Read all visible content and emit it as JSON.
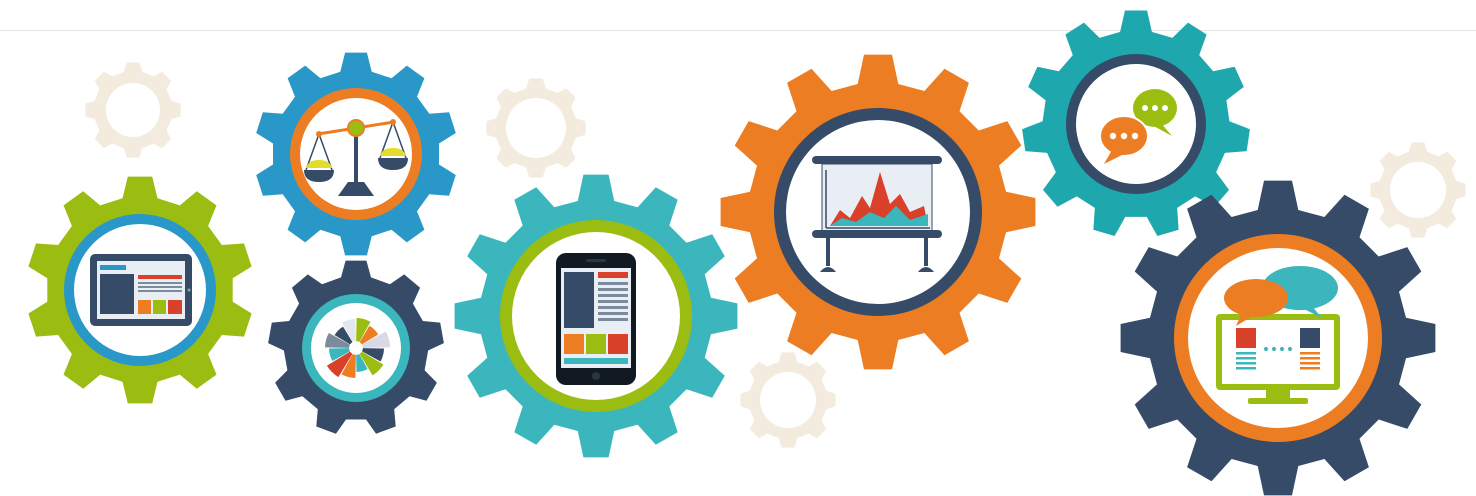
{
  "palette": {
    "green": "#9bbd12",
    "blue": "#2a97c9",
    "navy": "#354b68",
    "teal": "#3bb6bd",
    "orange": "#ec7d22",
    "dark_teal": "#1ea8ad",
    "beige": "#f4ebdf",
    "red": "#d9412b",
    "yellow": "#e3dc2a",
    "light_rule": "#e3e3e3"
  },
  "gears": [
    {
      "name": "beige-small-gear-1",
      "icon": "none",
      "color": "#f4ebdf"
    },
    {
      "name": "green-gear",
      "icon": "tablet-icon",
      "color": "#9bbd12",
      "ring": "#2a97c9"
    },
    {
      "name": "blue-gear",
      "icon": "balance-scale-icon",
      "color": "#2a97c9",
      "ring": "#ec7d22"
    },
    {
      "name": "navy-small-gear",
      "icon": "pie-wheel-chart-icon",
      "color": "#354b68",
      "ring": "#3bb6bd"
    },
    {
      "name": "beige-small-gear-2",
      "icon": "none",
      "color": "#f4ebdf"
    },
    {
      "name": "teal-gear",
      "icon": "smartphone-icon",
      "color": "#3bb6bd",
      "ring": "#9bbd12"
    },
    {
      "name": "beige-small-gear-3",
      "icon": "none",
      "color": "#f4ebdf"
    },
    {
      "name": "orange-gear",
      "icon": "presentation-board-icon",
      "color": "#ec7d22",
      "ring": "#354b68"
    },
    {
      "name": "dark-teal-gear",
      "icon": "chat-bubbles-icon",
      "color": "#1ea8ad",
      "ring": "#354b68"
    },
    {
      "name": "beige-small-gear-4",
      "icon": "none",
      "color": "#f4ebdf"
    },
    {
      "name": "navy-large-gear",
      "icon": "monitor-chat-icon",
      "color": "#354b68",
      "ring": "#ec7d22"
    }
  ]
}
